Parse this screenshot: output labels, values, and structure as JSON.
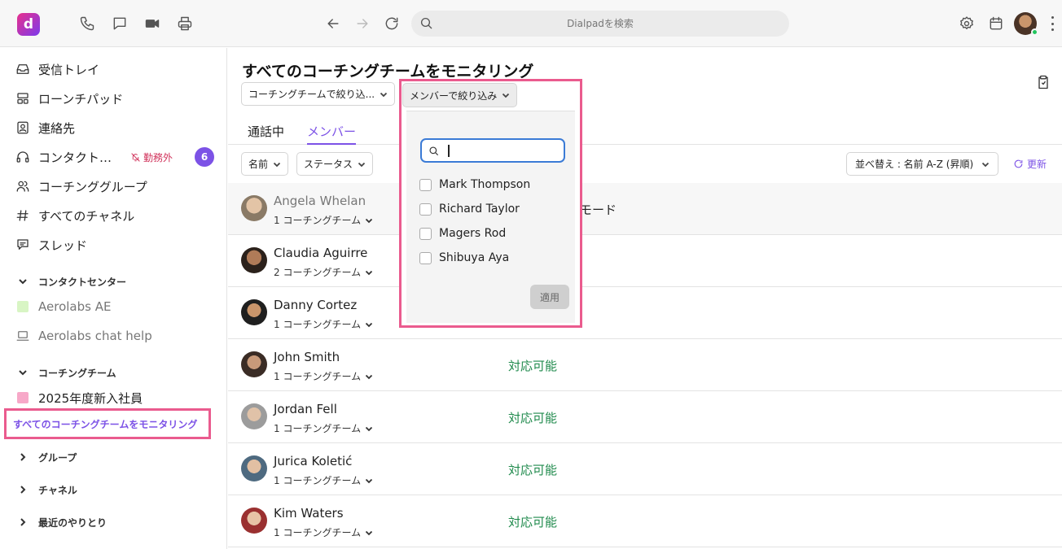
{
  "topbar": {
    "logo_letter": "d",
    "search_placeholder": "Dialpadを検索",
    "icons": [
      "phone-icon",
      "chat-icon",
      "video-icon",
      "printer-icon",
      "back-arrow-icon",
      "forward-arrow-icon",
      "reload-icon",
      "settings-icon",
      "calendar-icon"
    ]
  },
  "sidebar": {
    "items": [
      {
        "label": "受信トレイ",
        "icon": "inbox-icon"
      },
      {
        "label": "ローンチパッド",
        "icon": "launchpad-icon"
      },
      {
        "label": "連絡先",
        "icon": "contacts-icon"
      },
      {
        "label": "コンタクト…",
        "icon": "headset-icon",
        "status": "勤務外",
        "badge": "6"
      },
      {
        "label": "コーチンググループ",
        "icon": "people-icon"
      },
      {
        "label": "すべてのチャネル",
        "icon": "hash-icon"
      },
      {
        "label": "スレッド",
        "icon": "threads-icon"
      }
    ],
    "contact_center": {
      "heading": "コンタクトセンター",
      "items": [
        {
          "label": "Aerolabs AE",
          "color": "#d8f5c4"
        },
        {
          "label": "Aerolabs chat help"
        }
      ]
    },
    "coaching_team": {
      "heading": "コーチングチーム",
      "items": [
        {
          "label": "2025年度新入社員",
          "color": "#f7a8c8"
        }
      ],
      "active_link": "すべてのコーチングチームをモニタリング"
    },
    "collapsed_sections": [
      "グループ",
      "チャネル",
      "最近のやりとり"
    ]
  },
  "main": {
    "title": "すべてのコーチングチームをモニタリング",
    "filters": {
      "coaching_team": "コーチングチームで絞り込...",
      "member": "メンバーで絞り込み"
    },
    "tabs": [
      {
        "label": "通話中"
      },
      {
        "label": "メンバー",
        "active": true
      }
    ],
    "sub_filters": {
      "name": "名前",
      "status": "ステータス"
    },
    "sort": "並べ替え : 名前 A-Z (昇順)",
    "refresh": "更新",
    "members": [
      {
        "name": "Angela Whelan",
        "teams": "1 コーチングチーム",
        "status": "モード",
        "avatar": "#b79a7a"
      },
      {
        "name": "Claudia Aguirre",
        "teams": "2 コーチングチーム",
        "status": "",
        "avatar": "#6b4a3a"
      },
      {
        "name": "Danny Cortez",
        "teams": "1 コーチングチーム",
        "status": "",
        "avatar": "#3d3d3d"
      },
      {
        "name": "John Smith",
        "teams": "1 コーチングチーム",
        "status": "対応可能",
        "avatar": "#5a4a42"
      },
      {
        "name": "Jordan Fell",
        "teams": "1 コーチングチーム",
        "status": "対応可能",
        "avatar": "#9a8a7a"
      },
      {
        "name": "Jurica Koletić",
        "teams": "1 コーチングチーム",
        "status": "対応可能",
        "avatar": "#6a7a8a"
      },
      {
        "name": "Kim Waters",
        "teams": "1 コーチングチーム",
        "status": "対応可能",
        "avatar": "#b25a5a"
      }
    ],
    "member_dropdown": {
      "button": "メンバーで絞り込み",
      "search_value": "",
      "options": [
        "Mark Thompson",
        "Richard Taylor",
        "Magers Rod",
        "Shibuya Aya"
      ],
      "apply": "適用"
    }
  }
}
